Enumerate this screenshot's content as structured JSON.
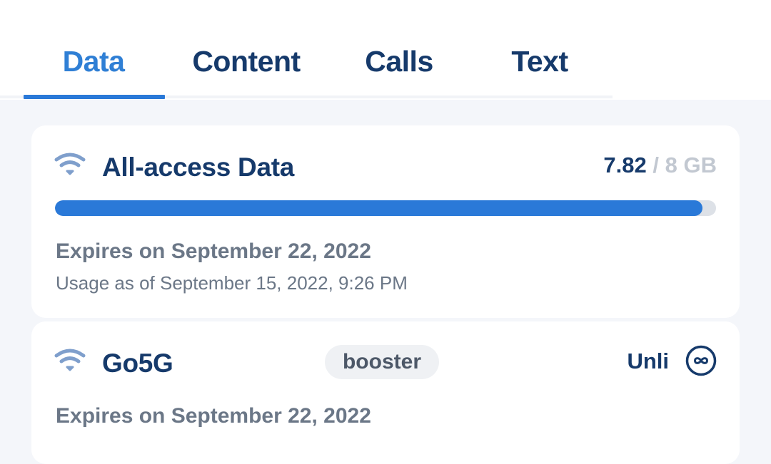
{
  "tabs": [
    {
      "label": "Data",
      "active": true
    },
    {
      "label": "Content",
      "active": false
    },
    {
      "label": "Calls",
      "active": false
    },
    {
      "label": "Text",
      "active": false
    }
  ],
  "plans": [
    {
      "icon": "wifi-icon",
      "name": "All-access Data",
      "used": "7.82",
      "separator": "/",
      "total": "8 GB",
      "progress_fraction": 0.98,
      "expiry": "Expires on September 22, 2022",
      "usage_as_of": "Usage as of September 15, 2022, 9:26 PM"
    },
    {
      "icon": "wifi-icon",
      "name": "Go5G",
      "badge": "booster",
      "allowance": "Unli",
      "allowance_icon": "infinity-icon",
      "expiry": "Expires on September 22, 2022"
    }
  ],
  "colors": {
    "accent": "#2a79d8",
    "active_tab": "#2f7fd5",
    "title_navy": "#163a6b",
    "muted_text": "#6b7787",
    "icon_blue": "#7f9fcc",
    "track": "#dde1e7",
    "page_bg": "#f4f6fa"
  }
}
